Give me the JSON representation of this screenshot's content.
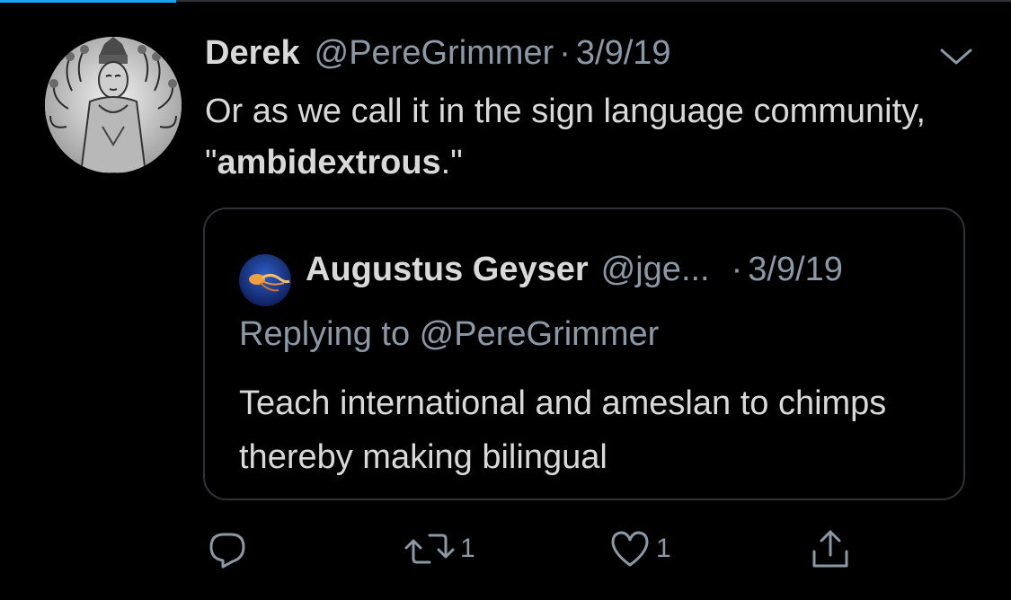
{
  "tweet": {
    "author_name": "Derek",
    "author_handle": "@PereGrimmer",
    "separator": "·",
    "date": "3/9/19",
    "text_before": "Or as we call it in the sign language community, \"",
    "text_bold": "ambidextrous",
    "text_after": ".\""
  },
  "quoted_tweet": {
    "author_name": "Augustus Geyser",
    "author_handle": "@jge...",
    "separator": "·",
    "date": "3/9/19",
    "reply_context": "Replying to @PereGrimmer",
    "text": "Teach international and ameslan to chimps thereby making bilingual"
  },
  "actions": {
    "reply_icon": "reply-icon",
    "retweet_icon": "retweet-icon",
    "retweet_count": "1",
    "like_icon": "heart-icon",
    "like_count": "1",
    "share_icon": "share-icon"
  },
  "colors": {
    "background": "#000000",
    "text_primary": "#d9d9d9",
    "text_secondary": "#8b98a5",
    "border": "#2f3336",
    "accent": "#1da1f2"
  }
}
